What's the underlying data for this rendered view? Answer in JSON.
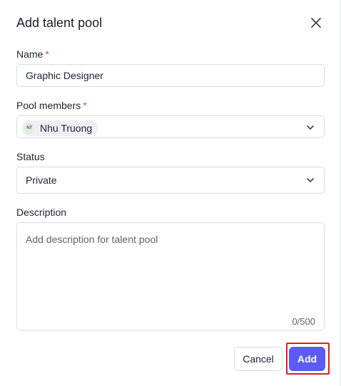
{
  "dialog": {
    "title": "Add talent pool",
    "close_icon": "close-icon"
  },
  "name_field": {
    "label": "Name",
    "required_mark": "*",
    "value": "Graphic Designer"
  },
  "pool_members": {
    "label": "Pool members",
    "required_mark": "*",
    "members": [
      {
        "initials": "NT",
        "name": "Nhu Truong"
      }
    ]
  },
  "status": {
    "label": "Status",
    "selected": "Private"
  },
  "description": {
    "label": "Description",
    "placeholder": "Add description for talent pool",
    "counter": "0/500"
  },
  "footer": {
    "cancel_label": "Cancel",
    "add_label": "Add"
  },
  "colors": {
    "primary": "#5b5bf6",
    "required": "#e5484d",
    "highlight": "#e01e1e"
  }
}
